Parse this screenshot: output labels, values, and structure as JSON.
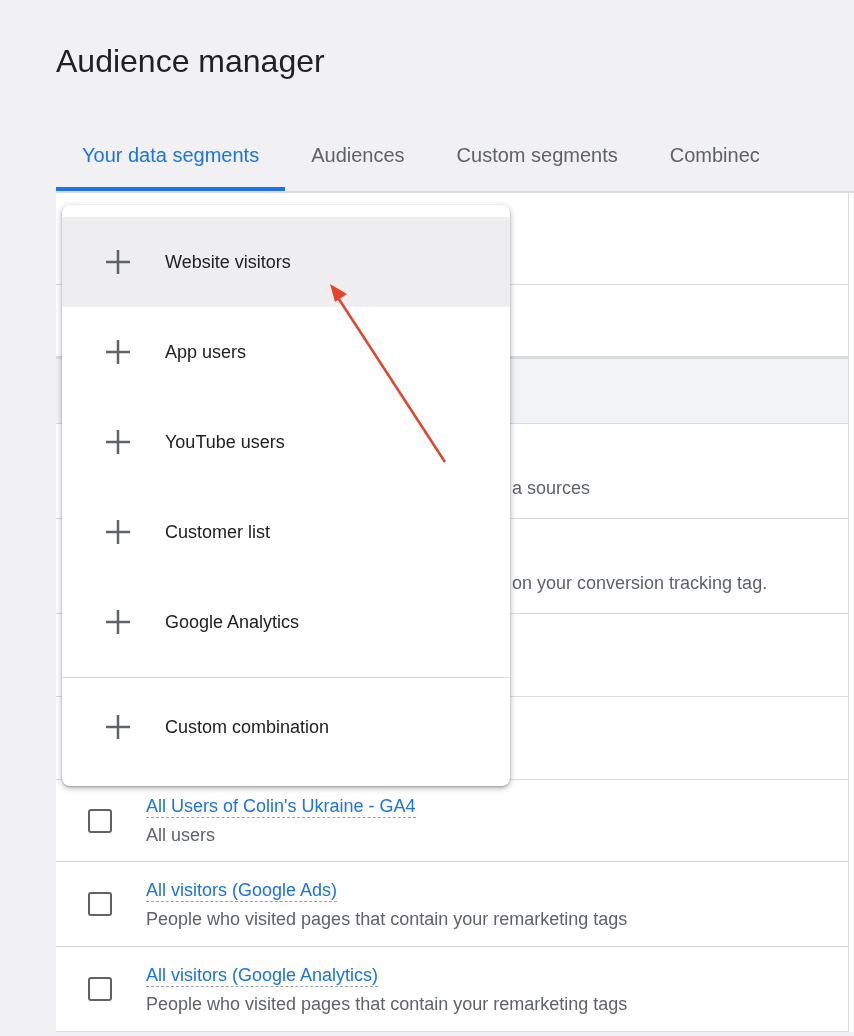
{
  "page_title": "Audience manager",
  "tabs": [
    {
      "label": "Your data segments",
      "selected": true
    },
    {
      "label": "Audiences",
      "selected": false
    },
    {
      "label": "Custom segments",
      "selected": false
    },
    {
      "label": "Combinec",
      "selected": false
    }
  ],
  "table": {
    "rows": [
      {
        "kind": "blank"
      },
      {
        "kind": "blank"
      },
      {
        "kind": "header"
      },
      {
        "kind": "partial",
        "description": "a sources"
      },
      {
        "kind": "partial",
        "description": "on your conversion tracking tag."
      },
      {
        "kind": "blank"
      },
      {
        "kind": "blank"
      },
      {
        "kind": "segment",
        "checked": false,
        "name": "All Users of Colin's Ukraine - GA4",
        "description": "All users"
      },
      {
        "kind": "segment",
        "checked": false,
        "name": "All visitors (Google Ads)",
        "description": "People who visited pages that contain your remarketing tags"
      },
      {
        "kind": "segment",
        "checked": false,
        "name": "All visitors (Google Analytics)",
        "description": "People who visited pages that contain your remarketing tags"
      }
    ]
  },
  "menu": {
    "items": [
      {
        "label": "Website visitors",
        "selected": true,
        "kind": "item"
      },
      {
        "label": "App users",
        "selected": false,
        "kind": "item"
      },
      {
        "label": "YouTube users",
        "selected": false,
        "kind": "item"
      },
      {
        "label": "Customer list",
        "selected": false,
        "kind": "item"
      },
      {
        "label": "Google Analytics",
        "selected": false,
        "kind": "item"
      },
      {
        "kind": "divider"
      },
      {
        "label": "Custom combination",
        "selected": false,
        "kind": "item"
      }
    ]
  }
}
